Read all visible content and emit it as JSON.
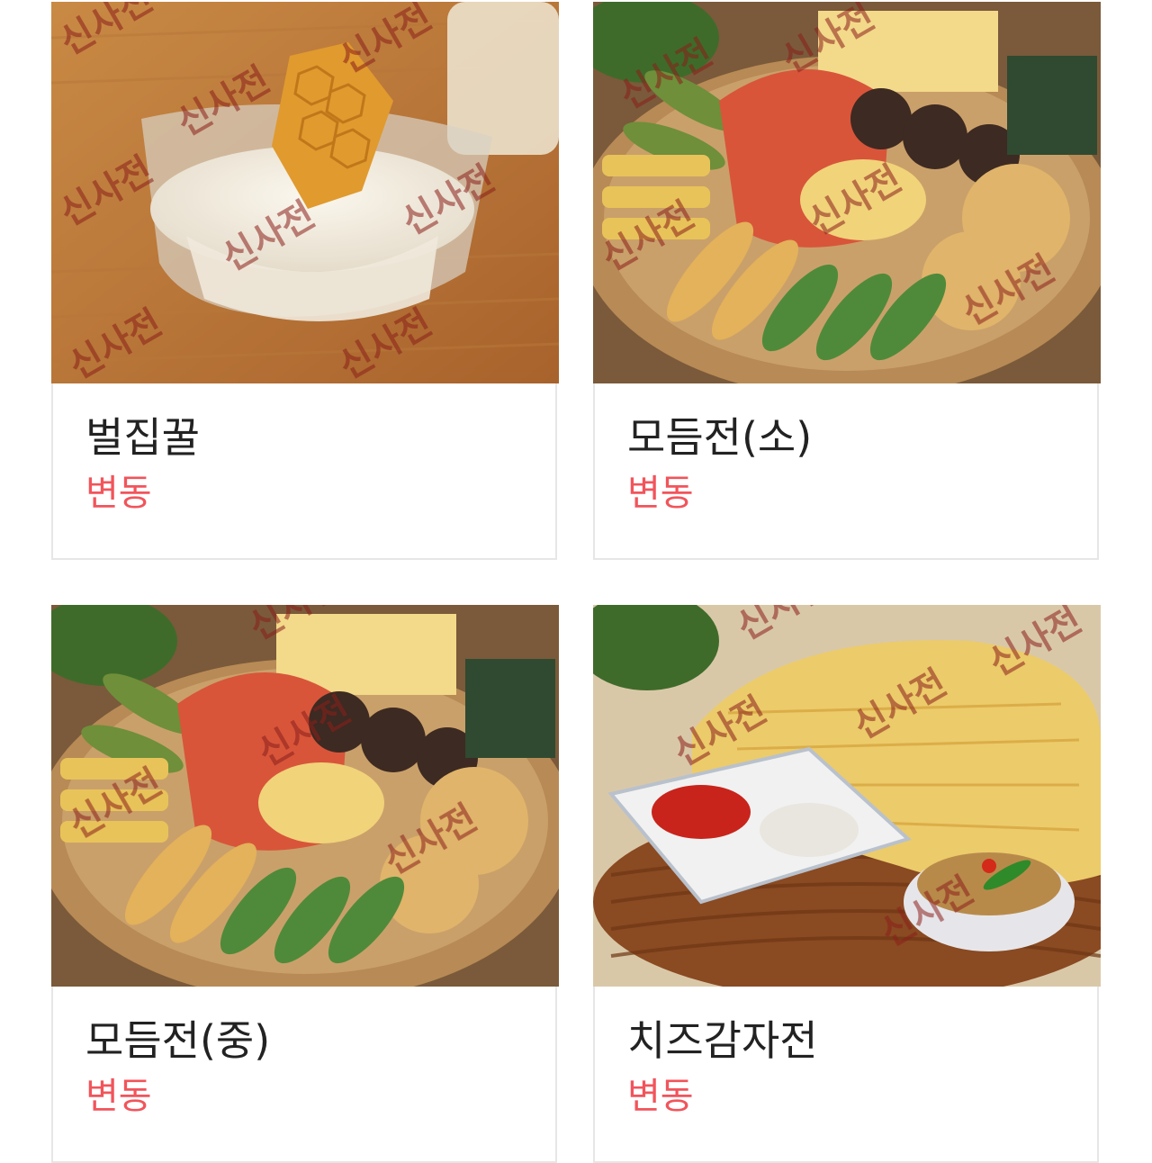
{
  "menu": {
    "items": [
      {
        "name": "벌집꿀",
        "price": "변동",
        "photo_icon": "honeycomb-milk-photo"
      },
      {
        "name": "모듬전(소)",
        "price": "변동",
        "photo_icon": "assorted-jeon-platter-photo"
      },
      {
        "name": "모듬전(중)",
        "price": "변동",
        "photo_icon": "assorted-jeon-platter-photo"
      },
      {
        "name": "치즈감자전",
        "price": "변동",
        "photo_icon": "cheese-potato-pancake-photo"
      }
    ],
    "watermark": "신사전",
    "colors": {
      "price": "#f2545b",
      "name": "#222222",
      "card_border": "#e6e6e6"
    }
  }
}
